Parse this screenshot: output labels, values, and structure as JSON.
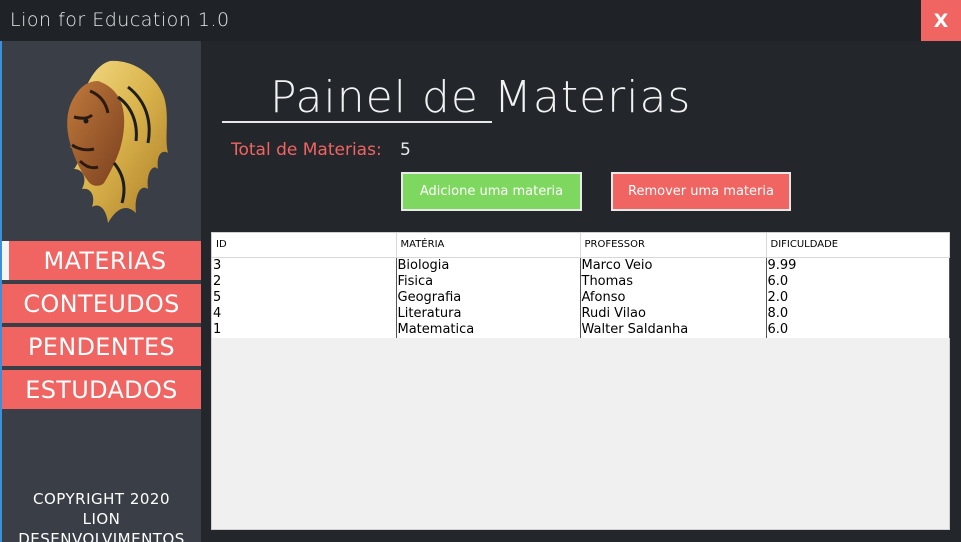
{
  "window": {
    "title": "Lion for Education 1.0",
    "close_label": "X"
  },
  "sidebar": {
    "items": [
      {
        "label": "MATERIAS"
      },
      {
        "label": "CONTEUDOS"
      },
      {
        "label": "PENDENTES"
      },
      {
        "label": "ESTUDADOS"
      }
    ],
    "copyright_line1": "COPYRIGHT 2020",
    "copyright_line2": "LION DESENVOLVIMENTOS"
  },
  "main": {
    "title": "Painel de Materias",
    "total_label": "Total de Materias:",
    "total_value": "5",
    "add_button": "Adicione uma materia",
    "remove_button": "Remover uma materia"
  },
  "table": {
    "columns": [
      "ID",
      "MATÉRIA",
      "PROFESSOR",
      "DIFICULDADE"
    ],
    "rows": [
      [
        "3",
        "Biologia",
        "Marco Veio",
        "9.99"
      ],
      [
        "2",
        "Fisica",
        "Thomas",
        "6.0"
      ],
      [
        "5",
        "Geografia",
        "Afonso",
        "2.0"
      ],
      [
        "4",
        "Literatura",
        "Rudi Vilao",
        "8.0"
      ],
      [
        "1",
        "Matematica",
        "Walter Saldanha",
        "6.0"
      ]
    ]
  },
  "colors": {
    "accent": "#f06461",
    "success": "#7ed85f",
    "sidebar": "#3a3f47",
    "background": "#23272c"
  }
}
